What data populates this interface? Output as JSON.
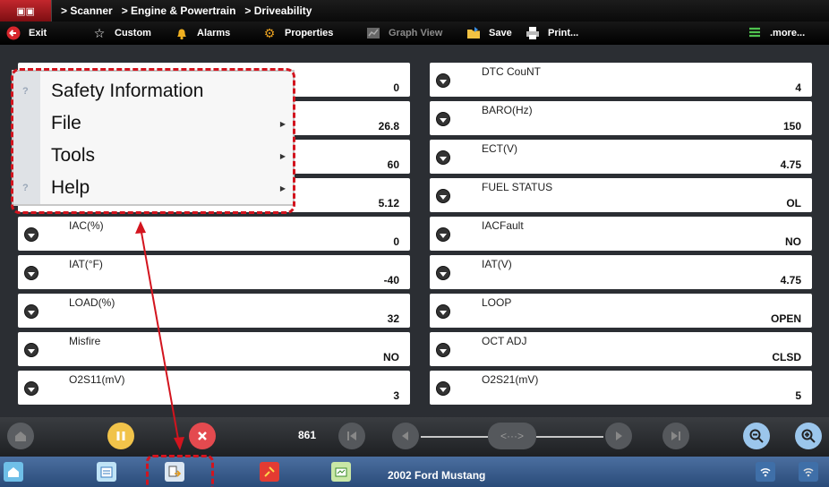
{
  "breadcrumb": [
    "> Scanner",
    "> Engine & Powertrain",
    "> Driveability"
  ],
  "toolbar": {
    "exit": "Exit",
    "custom": "Custom",
    "alarms": "Alarms",
    "properties": "Properties",
    "graph_view": "Graph View",
    "save": "Save",
    "print": "Print...",
    "more": ".more..."
  },
  "menu": {
    "items": [
      {
        "label": "Safety Information",
        "has_submenu": false
      },
      {
        "label": "File",
        "has_submenu": true
      },
      {
        "label": "Tools",
        "has_submenu": true
      },
      {
        "label": "Help",
        "has_submenu": true
      }
    ]
  },
  "left_rows": [
    {
      "name": "",
      "value": "0"
    },
    {
      "name": "",
      "value": "26.8"
    },
    {
      "name": "",
      "value": "60"
    },
    {
      "name": "",
      "value": "5.12"
    },
    {
      "name": "IAC(%)",
      "value": "0"
    },
    {
      "name": "IAT(°F)",
      "value": "-40"
    },
    {
      "name": "LOAD(%)",
      "value": "32"
    },
    {
      "name": "Misfire",
      "value": "NO"
    },
    {
      "name": "O2S11(mV)",
      "value": "3"
    }
  ],
  "right_rows": [
    {
      "name": "DTC CouNT",
      "value": "4"
    },
    {
      "name": "BARO(Hz)",
      "value": "150"
    },
    {
      "name": "ECT(V)",
      "value": "4.75"
    },
    {
      "name": "FUEL STATUS",
      "value": "OL"
    },
    {
      "name": "IACFault",
      "value": "NO"
    },
    {
      "name": "IAT(V)",
      "value": "4.75"
    },
    {
      "name": "LOOP",
      "value": "OPEN"
    },
    {
      "name": "OCT ADJ",
      "value": "CLSD"
    },
    {
      "name": "O2S21(mV)",
      "value": "5"
    }
  ],
  "controls": {
    "frame_count": "861"
  },
  "taskbar": {
    "vehicle": "2002 Ford Mustang"
  },
  "colors": {
    "highlight": "#d3141e",
    "taskbar": "#3a5d8f"
  }
}
